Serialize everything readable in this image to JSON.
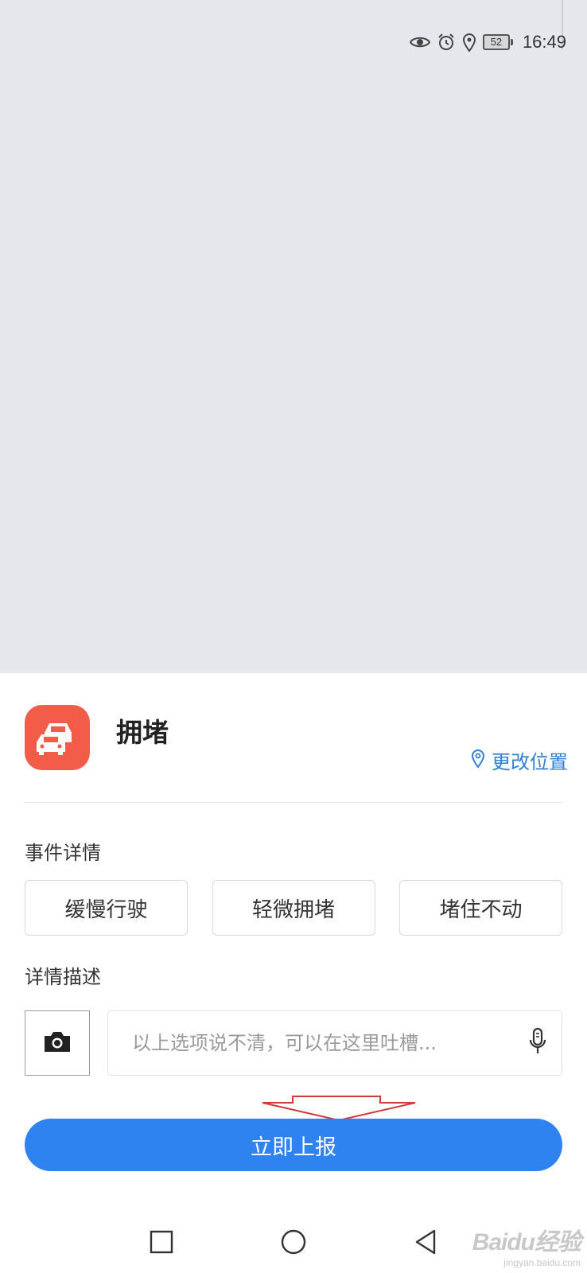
{
  "status_bar": {
    "battery_level": "52",
    "time": "16:49",
    "icons": [
      "eye-icon",
      "alarm-icon",
      "location-icon",
      "battery-icon"
    ]
  },
  "event": {
    "icon": "car-traffic-icon",
    "title": "拥堵",
    "change_location_label": "更改位置",
    "accent_color": "#f25c49",
    "link_color": "#2f7fd6"
  },
  "details": {
    "section_label": "事件详情",
    "options": [
      {
        "label": "缓慢行驶"
      },
      {
        "label": "轻微拥堵"
      },
      {
        "label": "堵住不动"
      }
    ]
  },
  "description": {
    "section_label": "详情描述",
    "placeholder": "以上选项说不清，可以在这里吐槽...",
    "camera_icon": "camera-icon",
    "mic_icon": "microphone-icon"
  },
  "submit": {
    "label": "立即上报",
    "color": "#2f83f0"
  },
  "nav_bar": {
    "icons": [
      "square-icon",
      "circle-icon",
      "back-triangle-icon"
    ]
  },
  "watermark": {
    "logo": "Baidu经验",
    "url": "jingyan.baidu.com"
  }
}
